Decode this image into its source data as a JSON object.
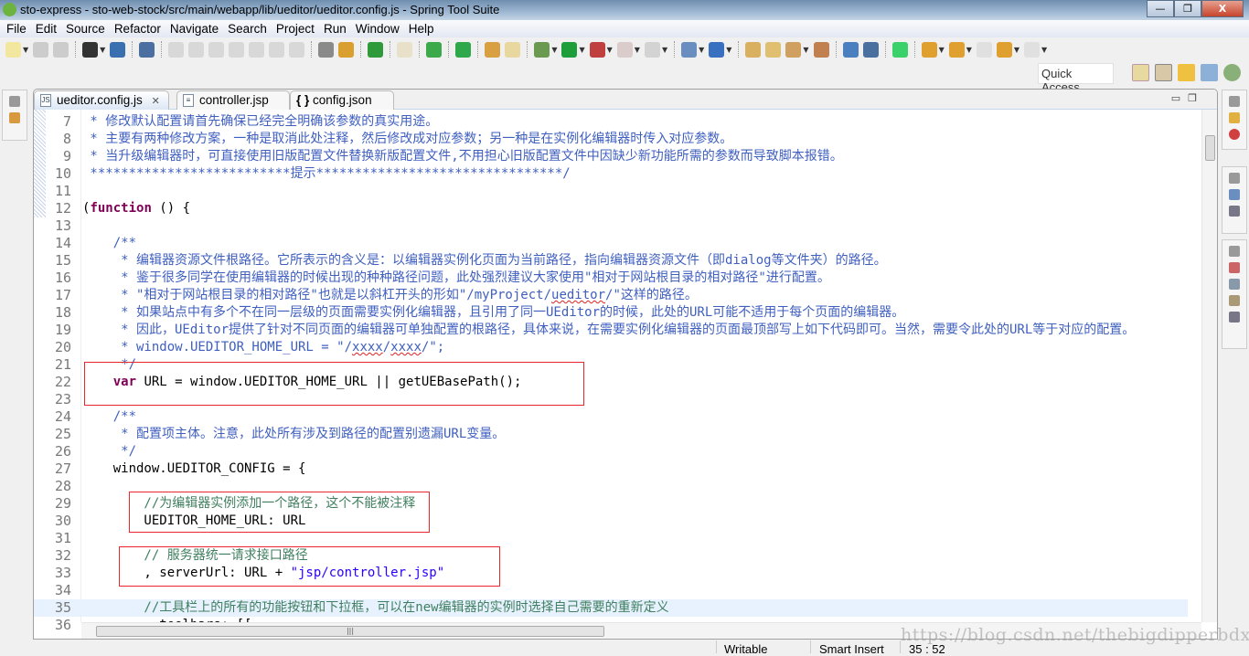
{
  "window": {
    "title": "sto-express - sto-web-stock/src/main/webapp/lib/ueditor/ueditor.config.js - Spring Tool Suite",
    "minimize": "—",
    "restore": "❐",
    "close": "X"
  },
  "menu": [
    "File",
    "Edit",
    "Source",
    "Refactor",
    "Navigate",
    "Search",
    "Project",
    "Run",
    "Window",
    "Help"
  ],
  "toolbar": {
    "icons": [
      "new-icon",
      "save-icon",
      "save-all-icon",
      "user-icon",
      "console-icon",
      "skip-breakpoints-icon",
      "resume-icon",
      "suspend-icon",
      "terminate-icon",
      "disconnect-icon",
      "step-into-icon",
      "step-over-icon",
      "step-return-icon",
      "use-step-filters-icon",
      "drop-to-frame-icon",
      "spring-boot-icon",
      "toggle-editor-icon",
      "spring-refresh-icon",
      "spring-green-icon",
      "open-type-icon",
      "toggle-mark-occurrences-icon",
      "debug-icon",
      "run-icon",
      "coverage-icon",
      "stop-icon",
      "external-tools-icon",
      "new-web-icon",
      "new-spring-icon",
      "open-folder-icon",
      "open-project-icon",
      "pencil-icon",
      "open-task-icon",
      "web-browser-icon",
      "launch-icon",
      "green-square-icon",
      "next-annotation-icon",
      "prev-annotation-icon",
      "last-edit-icon",
      "back-icon",
      "forward-icon"
    ],
    "colors": {
      "accent": "#6db33f",
      "debug": "#2e8b57",
      "run": "#1e9e3a"
    }
  },
  "quick_access": {
    "placeholder": "Quick Access"
  },
  "perspectives": [
    "open-perspective-icon",
    "spring-perspective-icon",
    "sql-perspective-icon",
    "data-perspective-icon",
    "debug-perspective-icon"
  ],
  "tabs": [
    {
      "label": "ueditor.config.js",
      "icon": "js-file-icon",
      "active": true,
      "close": "✕"
    },
    {
      "label": "controller.jsp",
      "icon": "jsp-file-icon",
      "active": false
    },
    {
      "label": "config.json",
      "icon": "json-braces-icon",
      "active": false,
      "icon_text": "{ }"
    }
  ],
  "editor": {
    "current_line": 35,
    "lines": [
      {
        "n": "7",
        "segs": [
          {
            "c": "comment",
            "t": " * 修改默认配置请首先确保已经完全明确该参数的真实用途。"
          }
        ]
      },
      {
        "n": "8",
        "segs": [
          {
            "c": "comment",
            "t": " * 主要有两种修改方案，一种是取消此处注释，然后修改成对应参数；另一种是在实例化编辑器时传入对应参数。"
          }
        ]
      },
      {
        "n": "9",
        "segs": [
          {
            "c": "comment",
            "t": " * 当升级编辑器时，可直接使用旧版配置文件替换新版配置文件,不用担心旧版配置文件中因缺少新功能所需的参数而导致脚本报错。"
          }
        ]
      },
      {
        "n": "10",
        "segs": [
          {
            "c": "comment",
            "t": " **************************提示********************************/"
          }
        ]
      },
      {
        "n": "11",
        "segs": []
      },
      {
        "n": "12",
        "segs": [
          {
            "c": "plain",
            "t": "("
          },
          {
            "c": "kw",
            "t": "function"
          },
          {
            "c": "plain",
            "t": " () {"
          }
        ]
      },
      {
        "n": "13",
        "segs": []
      },
      {
        "n": "14",
        "segs": [
          {
            "c": "comment",
            "t": "    /**"
          }
        ]
      },
      {
        "n": "15",
        "segs": [
          {
            "c": "comment",
            "t": "     * 编辑器资源文件根路径。它所表示的含义是：以编辑器实例化页面为当前路径，指向编辑器资源文件（即dialog等文件夹）的路径。"
          }
        ]
      },
      {
        "n": "16",
        "segs": [
          {
            "c": "comment",
            "t": "     * 鉴于很多同学在使用编辑器的时候出现的种种路径问题，此处强烈建议大家使用\"相对于网站根目录的相对路径\"进行配置。"
          }
        ]
      },
      {
        "n": "17",
        "segs": [
          {
            "c": "comment",
            "t": "     * \"相对于网站根目录的相对路径\"也就是以斜杠开头的形如\"/myProject/"
          },
          {
            "c": "comment squiggle",
            "t": "ueditor"
          },
          {
            "c": "comment",
            "t": "/\"这样的路径。"
          }
        ]
      },
      {
        "n": "18",
        "segs": [
          {
            "c": "comment",
            "t": "     * 如果站点中有多个不在同一层级的页面需要实例化编辑器，且引用了同一UEditor的时候，此处的URL可能不适用于每个页面的编辑器。"
          }
        ]
      },
      {
        "n": "19",
        "segs": [
          {
            "c": "comment",
            "t": "     * 因此，UEditor提供了针对不同页面的编辑器可单独配置的根路径，具体来说，在需要实例化编辑器的页面最顶部写上如下代码即可。当然，需要令此处的URL等于对应的配置。"
          }
        ]
      },
      {
        "n": "20",
        "segs": [
          {
            "c": "comment",
            "t": "     * window.UEDITOR_HOME_URL = \"/"
          },
          {
            "c": "comment squiggle",
            "t": "xxxx"
          },
          {
            "c": "comment",
            "t": "/"
          },
          {
            "c": "comment squiggle",
            "t": "xxxx"
          },
          {
            "c": "comment",
            "t": "/\";"
          }
        ]
      },
      {
        "n": "21",
        "segs": [
          {
            "c": "comment",
            "t": "     */"
          }
        ]
      },
      {
        "n": "22",
        "segs": [
          {
            "c": "plain",
            "t": "    "
          },
          {
            "c": "kw",
            "t": "var"
          },
          {
            "c": "plain",
            "t": " URL = window.UEDITOR_HOME_URL || getUEBasePath();"
          }
        ]
      },
      {
        "n": "23",
        "segs": []
      },
      {
        "n": "24",
        "segs": [
          {
            "c": "comment",
            "t": "    /**"
          }
        ]
      },
      {
        "n": "25",
        "segs": [
          {
            "c": "comment",
            "t": "     * 配置项主体。注意，此处所有涉及到路径的配置别遗漏URL变量。"
          }
        ]
      },
      {
        "n": "26",
        "segs": [
          {
            "c": "comment",
            "t": "     */"
          }
        ]
      },
      {
        "n": "27",
        "segs": [
          {
            "c": "plain",
            "t": "    window.UEDITOR_CONFIG = {"
          }
        ]
      },
      {
        "n": "28",
        "segs": []
      },
      {
        "n": "29",
        "segs": [
          {
            "c": "lcomment",
            "t": "        //为编辑器实例添加一个路径，这个不能被注释"
          }
        ]
      },
      {
        "n": "30",
        "segs": [
          {
            "c": "plain",
            "t": "        UEDITOR_HOME_URL: URL"
          }
        ]
      },
      {
        "n": "31",
        "segs": []
      },
      {
        "n": "32",
        "segs": [
          {
            "c": "lcomment",
            "t": "        // 服务器统一请求接口路径"
          }
        ]
      },
      {
        "n": "33",
        "segs": [
          {
            "c": "plain",
            "t": "        , serverUrl: URL + "
          },
          {
            "c": "str",
            "t": "\"jsp/controller.jsp\""
          }
        ]
      },
      {
        "n": "34",
        "segs": []
      },
      {
        "n": "35",
        "segs": [
          {
            "c": "lcomment",
            "t": "        //工具栏上的所有的功能按钮和下拉框，可以在new编辑器的实例时选择自己需要的重新定义"
          }
        ]
      },
      {
        "n": "36",
        "segs": [
          {
            "c": "plain",
            "t": "        , toolbars: [["
          }
        ]
      }
    ]
  },
  "status": {
    "writable": "Writable",
    "insert_mode": "Smart Insert",
    "position": "35 : 52"
  },
  "watermark": "https://blog.csdn.net/thebigdipperbdx"
}
